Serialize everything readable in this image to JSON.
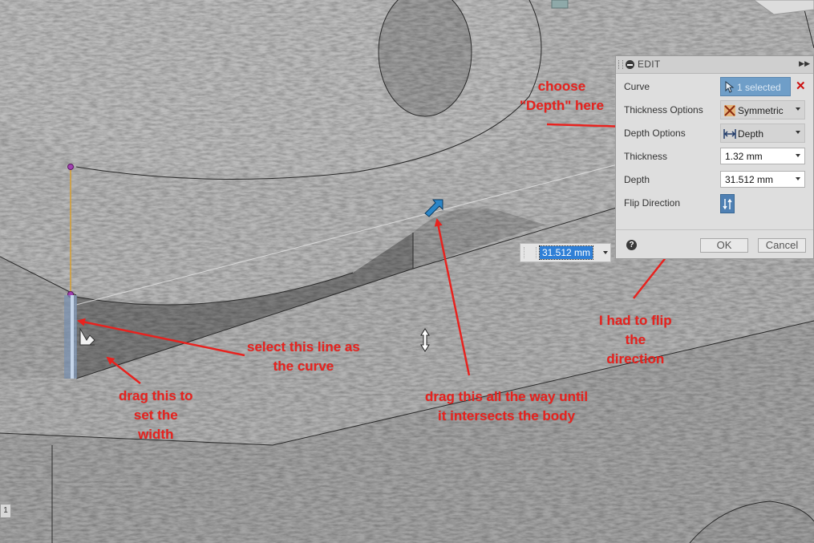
{
  "edit_panel": {
    "title": "EDIT",
    "rows": {
      "curve": {
        "label": "Curve",
        "value": "1 selected"
      },
      "thickness_options": {
        "label": "Thickness Options",
        "value": "Symmetric"
      },
      "depth_options": {
        "label": "Depth Options",
        "value": "Depth"
      },
      "thickness": {
        "label": "Thickness",
        "value": "1.32 mm"
      },
      "depth": {
        "label": "Depth",
        "value": "31.512 mm"
      },
      "flip_direction": {
        "label": "Flip Direction"
      }
    },
    "ok_label": "OK",
    "cancel_label": "Cancel",
    "help_glyph": "?"
  },
  "dimension_input": {
    "value": "31.512 mm"
  },
  "annotations": {
    "choose_depth": "choose\n\"Depth\" here",
    "select_line": "select this line as\nthe curve",
    "drag_width": "drag this to\nset the\nwidth",
    "drag_depth": "drag this all the way until\nit intersects the body",
    "flip": "I had to flip\nthe\ndirection"
  },
  "viewport": {
    "corner_number": "1"
  },
  "icons": {
    "collapse": "minus-circle-icon",
    "expand": "double-chevron-right-icon",
    "curve_select": "cursor-arrow-icon",
    "clear_selection": "close-icon",
    "thickness_options": "symmetric-icon",
    "depth_options": "depth-icon",
    "flip": "flip-direction-icon",
    "help": "help-icon",
    "depth_manipulator": "blue-arrow-manipulator-icon",
    "width_manipulator": "white-arrow-manipulator-icon",
    "move_cursor": "resize-vertical-cursor-icon"
  },
  "colors": {
    "annotation": "#e8221e",
    "selection_blue": "#6f9ec8",
    "flip_button": "#4f80b3",
    "highlight": "#2f7fd6"
  }
}
